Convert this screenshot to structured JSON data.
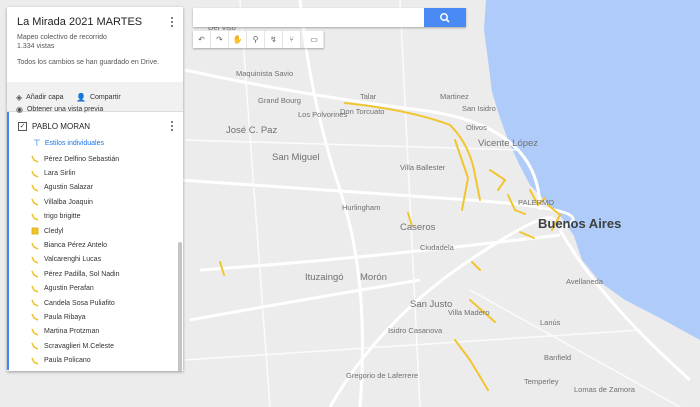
{
  "panel": {
    "title": "La Mirada 2021 MARTES",
    "subtitle": "Mapeo colectivo de recorrido",
    "views": "1.334 vistas",
    "saved_status": "Todos los cambios se han guardado en Drive.",
    "actions": {
      "add_layer": "Añadir capa",
      "share": "Compartir",
      "preview": "Obtener una vista previa"
    },
    "layer": {
      "name": "PABLO MORAN",
      "checked": true,
      "styles_label": "Estilos individuales",
      "items": [
        {
          "label": "Pérez Delfino Sebastián",
          "icon": "line-icon"
        },
        {
          "label": "Lara Sirlin",
          "icon": "line-icon"
        },
        {
          "label": "Agustin Salazar",
          "icon": "line-icon"
        },
        {
          "label": "Villalba Joaquin",
          "icon": "line-icon"
        },
        {
          "label": "trigo brigitte",
          "icon": "line-icon"
        },
        {
          "label": "Cledyl",
          "icon": "polygon-icon"
        },
        {
          "label": "Bianca Pérez Antelo",
          "icon": "line-icon"
        },
        {
          "label": "Valcarenghi Lucas",
          "icon": "line-icon"
        },
        {
          "label": "Pérez Padilla, Sol Nadin",
          "icon": "line-icon"
        },
        {
          "label": "Agustin Perafan",
          "icon": "line-icon"
        },
        {
          "label": "Candela Sosa Puliafito",
          "icon": "line-icon"
        },
        {
          "label": "Paula Ribaya",
          "icon": "line-icon"
        },
        {
          "label": "Martina Protzman",
          "icon": "line-icon"
        },
        {
          "label": "Scravaglieri M.Celeste",
          "icon": "line-icon"
        },
        {
          "label": "Paula Policano",
          "icon": "line-icon"
        }
      ]
    }
  },
  "search": {
    "placeholder": ""
  },
  "toolbar": [
    "undo-icon",
    "redo-icon",
    "hand-icon",
    "marker-icon",
    "draw-line-icon",
    "directions-icon",
    "ruler-icon"
  ],
  "map_labels": [
    {
      "text": "Del Viso",
      "kind": "small"
    },
    {
      "text": "Maquinista Savio",
      "kind": "small"
    },
    {
      "text": "Grand Bourg",
      "kind": "small"
    },
    {
      "text": "Los Polvorines",
      "kind": "small"
    },
    {
      "text": "Talar",
      "kind": "small"
    },
    {
      "text": "Martinez",
      "kind": "small"
    },
    {
      "text": "San Isidro",
      "kind": "small"
    },
    {
      "text": "Don Torcuato",
      "kind": "small"
    },
    {
      "text": "José C. Paz",
      "kind": "big"
    },
    {
      "text": "Olivos",
      "kind": "small"
    },
    {
      "text": "Vicente López",
      "kind": "big"
    },
    {
      "text": "San Miguel",
      "kind": "big"
    },
    {
      "text": "Villa Ballester",
      "kind": "small"
    },
    {
      "text": "Hurlingham",
      "kind": "small"
    },
    {
      "text": "Caseros",
      "kind": "big"
    },
    {
      "text": "PALERMO",
      "kind": "small"
    },
    {
      "text": "Buenos Aires",
      "kind": "city"
    },
    {
      "text": "Ciudadela",
      "kind": "small"
    },
    {
      "text": "Ituzaingó",
      "kind": "big"
    },
    {
      "text": "Morón",
      "kind": "big"
    },
    {
      "text": "Avellaneda",
      "kind": "small"
    },
    {
      "text": "San Justo",
      "kind": "big"
    },
    {
      "text": "Lanús",
      "kind": "small"
    },
    {
      "text": "Villa Madero",
      "kind": "small"
    },
    {
      "text": "Isidro Casanova",
      "kind": "small"
    },
    {
      "text": "Banfield",
      "kind": "small"
    },
    {
      "text": "Gregorio de Laferrere",
      "kind": "small"
    },
    {
      "text": "Lomas de Zamora",
      "kind": "small"
    },
    {
      "text": "Temperley",
      "kind": "small"
    }
  ],
  "colors": {
    "route": "#f2c530",
    "accent": "#4285f4",
    "water": "#aecbfa",
    "land": "#e8eaed",
    "road": "#ffffff"
  }
}
